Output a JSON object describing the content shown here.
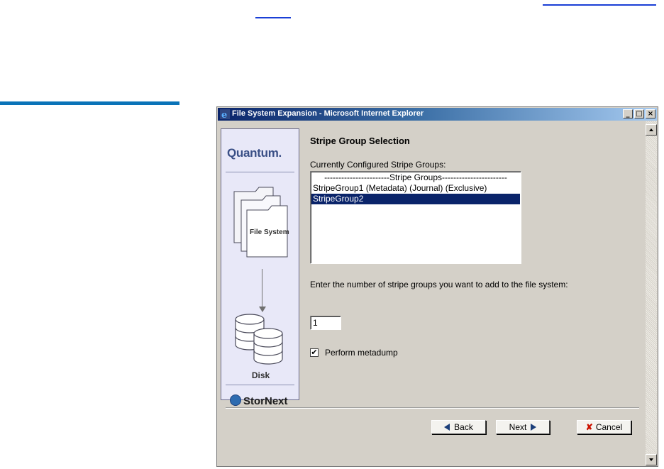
{
  "window": {
    "title": "File System Expansion - Microsoft Internet Explorer"
  },
  "controls": {
    "minimize": "_",
    "maximize": "□",
    "close": "×"
  },
  "sidebar": {
    "logo": "Quantum.",
    "graphic_label": "File System",
    "disk_label": "Disk",
    "brand": "StorNext"
  },
  "page": {
    "title": "Stripe Group Selection",
    "configured_label": "Currently Configured Stripe Groups:",
    "list_items": [
      "-----------------------Stripe Groups-----------------------",
      "StripeGroup1 (Metadata) (Journal) (Exclusive)",
      "StripeGroup2"
    ],
    "selected_index": 2,
    "count_prompt": "Enter the number of stripe groups you want to add to the file system:",
    "count_value": "1",
    "metadump_label": "Perform metadump",
    "metadump_checked": "✔"
  },
  "buttons": {
    "back": "Back",
    "next": "Next",
    "cancel": "Cancel"
  },
  "colors": {
    "selection": "#0a246a",
    "rule": "#0a73b8",
    "link": "#1a3fd6"
  }
}
